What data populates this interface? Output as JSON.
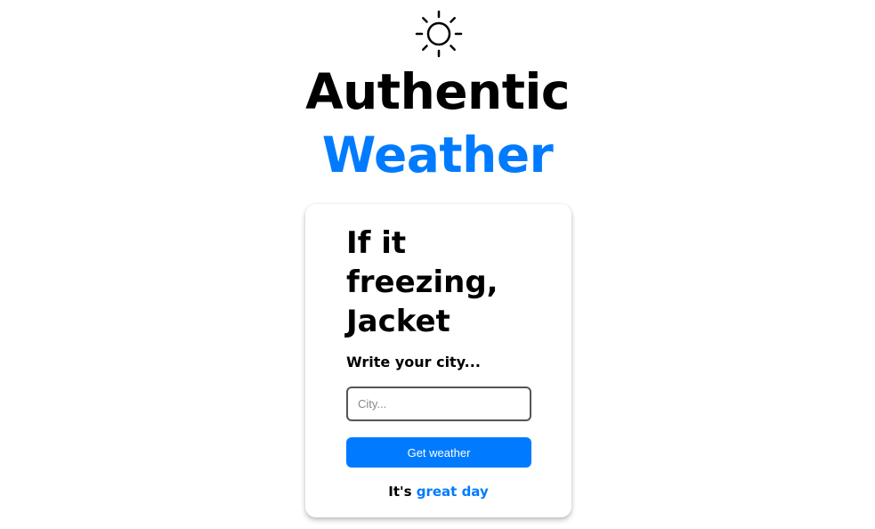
{
  "header": {
    "icon": "sun-icon",
    "title_line1": "Authentic",
    "title_line2": "Weather"
  },
  "card": {
    "heading": "If it freezing, Jacket",
    "city_label": "Write your city...",
    "city_input": {
      "value": "",
      "placeholder": "City..."
    },
    "button_label": "Get weather",
    "status_prefix": "It's",
    "status_highlight": "great day"
  },
  "colors": {
    "accent": "#007bff",
    "text": "#000000",
    "background": "#ffffff"
  }
}
